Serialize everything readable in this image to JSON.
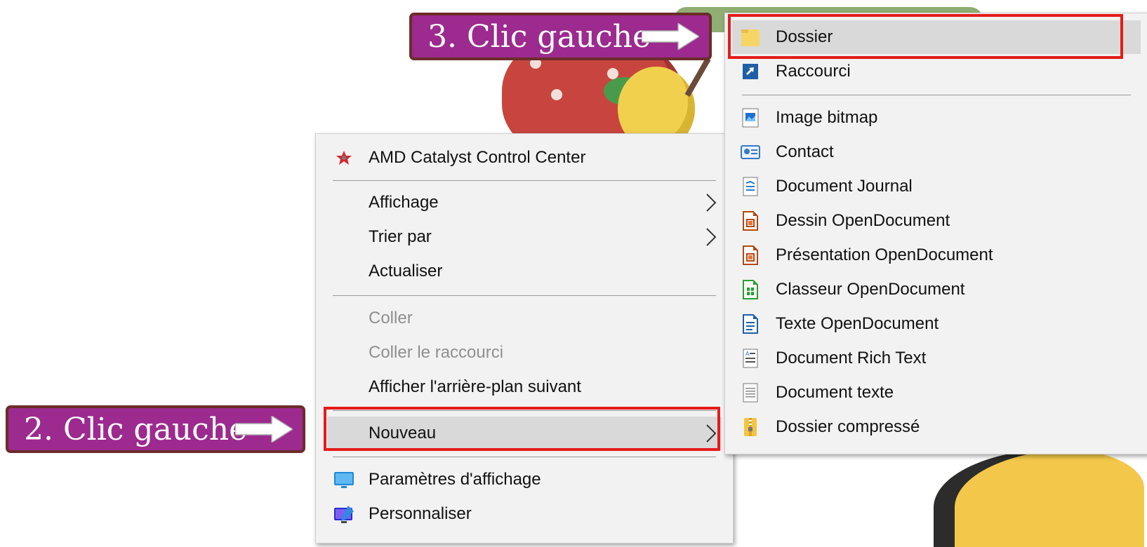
{
  "callouts": {
    "step2": "2. Clic gauche",
    "step3": "3. Clic gauche"
  },
  "context_menu": {
    "amd": "AMD Catalyst Control Center",
    "affichage": "Affichage",
    "trier_par": "Trier par",
    "actualiser": "Actualiser",
    "coller": "Coller",
    "coller_raccourci": "Coller le raccourci",
    "arriere_plan": "Afficher l'arrière-plan suivant",
    "nouveau": "Nouveau",
    "parametres": "Paramètres d'affichage",
    "personnaliser": "Personnaliser"
  },
  "new_submenu": {
    "dossier": "Dossier",
    "raccourci": "Raccourci",
    "image_bitmap": "Image bitmap",
    "contact": "Contact",
    "document_journal": "Document Journal",
    "dessin_od": "Dessin OpenDocument",
    "presentation_od": "Présentation OpenDocument",
    "classeur_od": "Classeur OpenDocument",
    "texte_od": "Texte OpenDocument",
    "rich_text": "Document Rich Text",
    "document_texte": "Document texte",
    "dossier_compresse": "Dossier compressé"
  },
  "colors": {
    "callout_bg": "#9c2a8f",
    "highlight_box": "#e51b1b",
    "menu_bg": "#f2f2f2"
  }
}
